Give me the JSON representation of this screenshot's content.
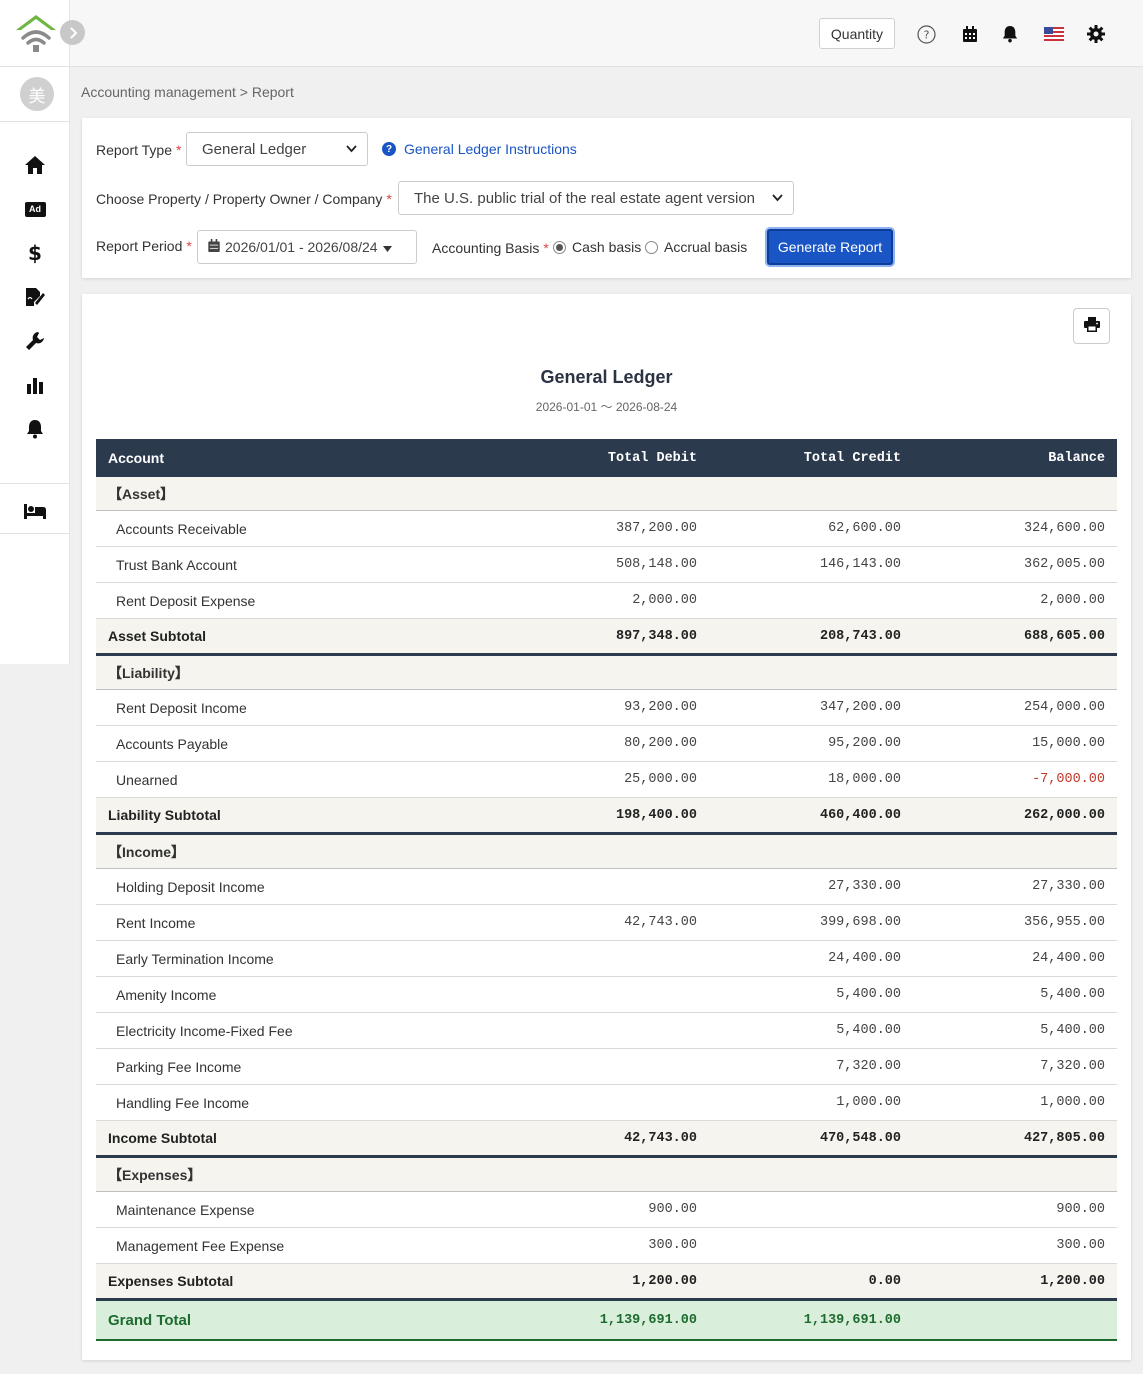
{
  "sidebar": {
    "avatar": "美",
    "icons": [
      "home-icon",
      "ad-icon",
      "dollar-icon",
      "signature-icon",
      "wrench-icon",
      "chart-icon",
      "bell-icon",
      "bed-icon"
    ],
    "ad_label": "Ad"
  },
  "topbar": {
    "quantity_label": "Quantity"
  },
  "breadcrumb": "Accounting management > Report",
  "filters": {
    "report_type_label": "Report Type",
    "report_type_value": "General Ledger",
    "instructions_link": "General Ledger Instructions",
    "property_label": "Choose Property / Property Owner / Company",
    "property_value": "The U.S. public trial of the real estate agent version",
    "period_label": "Report Period",
    "period_value": "2026/01/01 - 2026/08/24",
    "basis_label": "Accounting Basis",
    "basis_options": [
      "Cash basis",
      "Accrual basis"
    ],
    "basis_selected": "Cash basis",
    "generate_label": "Generate Report",
    "required_mark": "*"
  },
  "report": {
    "title": "General Ledger",
    "date_range": "2026-01-01 〜 2026-08-24",
    "columns": [
      "Account",
      "Total Debit",
      "Total Credit",
      "Balance"
    ],
    "sections": [
      {
        "category": "【Asset】",
        "rows": [
          {
            "account": "Accounts Receivable",
            "debit": "387,200.00",
            "credit": "62,600.00",
            "balance": "324,600.00"
          },
          {
            "account": "Trust Bank Account",
            "debit": "508,148.00",
            "credit": "146,143.00",
            "balance": "362,005.00"
          },
          {
            "account": "Rent Deposit Expense",
            "debit": "2,000.00",
            "credit": "",
            "balance": "2,000.00"
          }
        ],
        "subtotal": {
          "label": "Asset Subtotal",
          "debit": "897,348.00",
          "credit": "208,743.00",
          "balance": "688,605.00"
        }
      },
      {
        "category": "【Liability】",
        "rows": [
          {
            "account": "Rent Deposit Income",
            "debit": "93,200.00",
            "credit": "347,200.00",
            "balance": "254,000.00"
          },
          {
            "account": "Accounts Payable",
            "debit": "80,200.00",
            "credit": "95,200.00",
            "balance": "15,000.00"
          },
          {
            "account": "Unearned",
            "debit": "25,000.00",
            "credit": "18,000.00",
            "balance": "-7,000.00"
          }
        ],
        "subtotal": {
          "label": "Liability Subtotal",
          "debit": "198,400.00",
          "credit": "460,400.00",
          "balance": "262,000.00"
        }
      },
      {
        "category": "【Income】",
        "rows": [
          {
            "account": "Holding Deposit Income",
            "debit": "",
            "credit": "27,330.00",
            "balance": "27,330.00"
          },
          {
            "account": "Rent Income",
            "debit": "42,743.00",
            "credit": "399,698.00",
            "balance": "356,955.00"
          },
          {
            "account": "Early Termination Income",
            "debit": "",
            "credit": "24,400.00",
            "balance": "24,400.00"
          },
          {
            "account": "Amenity Income",
            "debit": "",
            "credit": "5,400.00",
            "balance": "5,400.00"
          },
          {
            "account": "Electricity Income-Fixed Fee",
            "debit": "",
            "credit": "5,400.00",
            "balance": "5,400.00"
          },
          {
            "account": "Parking Fee Income",
            "debit": "",
            "credit": "7,320.00",
            "balance": "7,320.00"
          },
          {
            "account": "Handling Fee Income",
            "debit": "",
            "credit": "1,000.00",
            "balance": "1,000.00"
          }
        ],
        "subtotal": {
          "label": "Income Subtotal",
          "debit": "42,743.00",
          "credit": "470,548.00",
          "balance": "427,805.00"
        }
      },
      {
        "category": "【Expenses】",
        "rows": [
          {
            "account": "Maintenance Expense",
            "debit": "900.00",
            "credit": "",
            "balance": "900.00"
          },
          {
            "account": "Management Fee Expense",
            "debit": "300.00",
            "credit": "",
            "balance": "300.00"
          }
        ],
        "subtotal": {
          "label": "Expenses Subtotal",
          "debit": "1,200.00",
          "credit": "0.00",
          "balance": "1,200.00"
        }
      }
    ],
    "grand_total": {
      "label": "Grand Total",
      "debit": "1,139,691.00",
      "credit": "1,139,691.00",
      "balance": ""
    }
  },
  "colors": {
    "accent": "#1a55c5",
    "table_header": "#2c3a4e",
    "negative": "#c0392b",
    "grand_total_bg": "#d9efdb",
    "grand_total_text": "#1d6b2e",
    "logo_green": "#6fb543"
  }
}
